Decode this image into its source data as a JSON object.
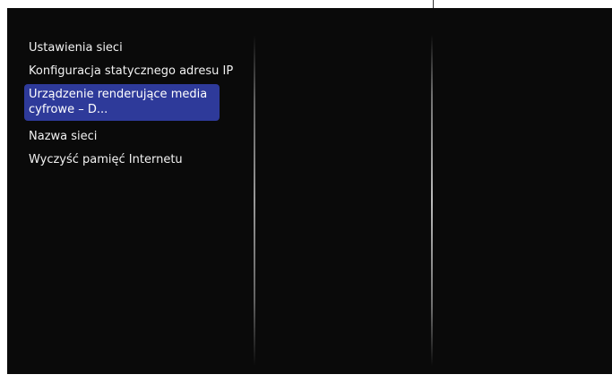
{
  "menu": {
    "items": [
      {
        "label": "Ustawienia sieci"
      },
      {
        "label": "Konfiguracja statycznego adresu IP"
      },
      {
        "label": "Urządzenie renderujące media cyfrowe – D...",
        "selected": true
      },
      {
        "label": "Nazwa sieci"
      },
      {
        "label": "Wyczyść pamięć Internetu"
      }
    ],
    "selected_index": 2
  },
  "colors": {
    "screen_background": "#0a0a0a",
    "selection_highlight": "#2e3a9a",
    "menu_text": "#f2f2f2"
  }
}
